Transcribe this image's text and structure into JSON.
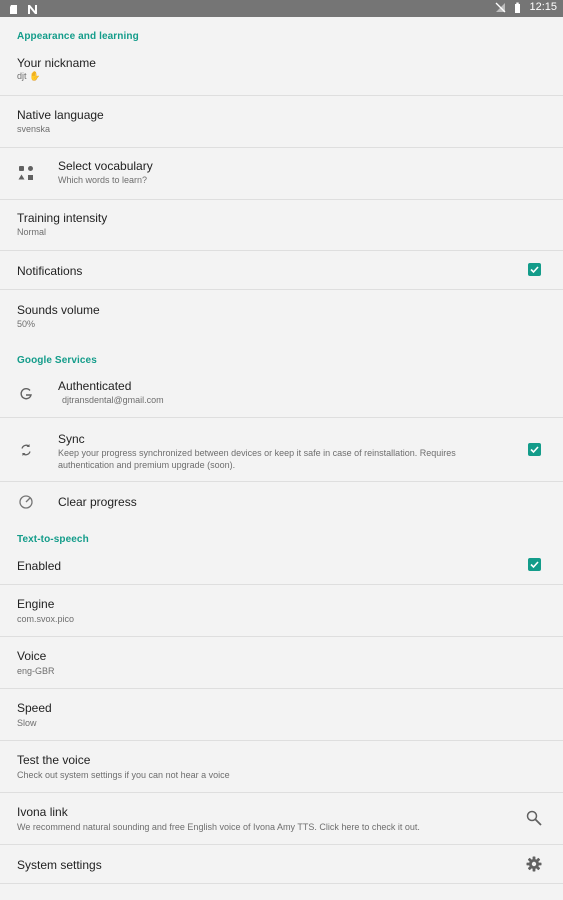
{
  "status_bar": {
    "time": "12:15",
    "left_icons": [
      "sd-card-icon",
      "notification-n-icon"
    ],
    "right_icons": [
      "no-signal-icon",
      "battery-icon"
    ]
  },
  "colors": {
    "accent": "#139c8a",
    "status_bar": "#757575",
    "background": "#f3f3f3"
  },
  "sections": {
    "appearance": "Appearance and learning",
    "google": "Google Services",
    "tts": "Text-to-speech"
  },
  "items": {
    "nickname": {
      "title": "Your nickname",
      "value": "djt"
    },
    "native_language": {
      "title": "Native language",
      "value": "svenska"
    },
    "vocabulary": {
      "title": "Select vocabulary",
      "subtitle": "Which words to learn?"
    },
    "training_intensity": {
      "title": "Training intensity",
      "value": "Normal"
    },
    "notifications": {
      "title": "Notifications",
      "checked": true
    },
    "sounds_volume": {
      "title": "Sounds volume",
      "value": "50%"
    },
    "authenticated": {
      "title": "Authenticated",
      "value": "djtransdental@gmail.com"
    },
    "sync": {
      "title": "Sync",
      "subtitle": "Keep your progress synchronized between devices or keep it safe in case of reinstallation. Requires authentication and premium upgrade (soon).",
      "checked": true
    },
    "clear_progress": {
      "title": "Clear progress"
    },
    "tts_enabled": {
      "title": "Enabled",
      "checked": true
    },
    "engine": {
      "title": "Engine",
      "value": "com.svox.pico"
    },
    "voice": {
      "title": "Voice",
      "value": "eng-GBR"
    },
    "speed": {
      "title": "Speed",
      "value": "Slow"
    },
    "test_voice": {
      "title": "Test the voice",
      "subtitle": "Check out system settings if you can not hear a voice"
    },
    "ivona": {
      "title": "Ivona link",
      "subtitle": "We recommend natural sounding and free English voice of Ivona Amy TTS. Click here to check it out."
    },
    "system_settings": {
      "title": "System settings"
    }
  }
}
